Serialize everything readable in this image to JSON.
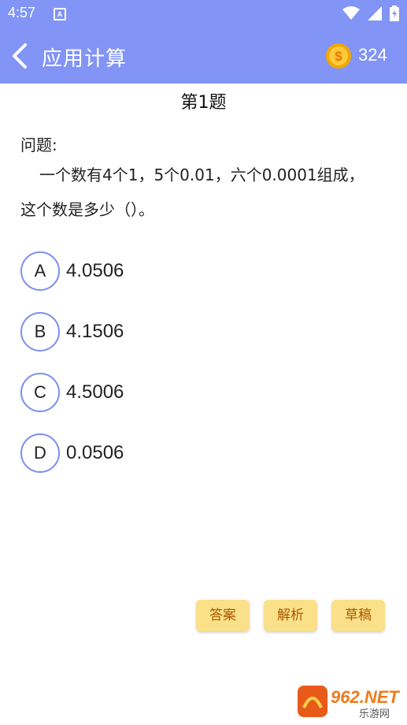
{
  "status_bar": {
    "time": "4:57",
    "notif_letter": "A"
  },
  "header": {
    "title": "应用计算",
    "coins": "324"
  },
  "question": {
    "number_label": "第1题",
    "label": "问题:",
    "text": "一个数有4个1，5个0.01，六个0.0001组成，这个数是多少（）。"
  },
  "options": [
    {
      "letter": "A",
      "text": "4.0506"
    },
    {
      "letter": "B",
      "text": "4.1506"
    },
    {
      "letter": "C",
      "text": "4.5006"
    },
    {
      "letter": "D",
      "text": "0.0506"
    }
  ],
  "actions": {
    "answer": "答案",
    "analysis": "解析",
    "draft": "草稿"
  },
  "watermark": {
    "main": "962.NET",
    "sub": "乐游网"
  },
  "colors": {
    "header": "#8294f5",
    "option_border": "#7d8ef0",
    "button_bg": "#fbe08a",
    "button_text": "#a85a00"
  },
  "icons": [
    "back-arrow-icon",
    "coin-icon",
    "wifi-icon",
    "signal-icon",
    "battery-icon"
  ]
}
